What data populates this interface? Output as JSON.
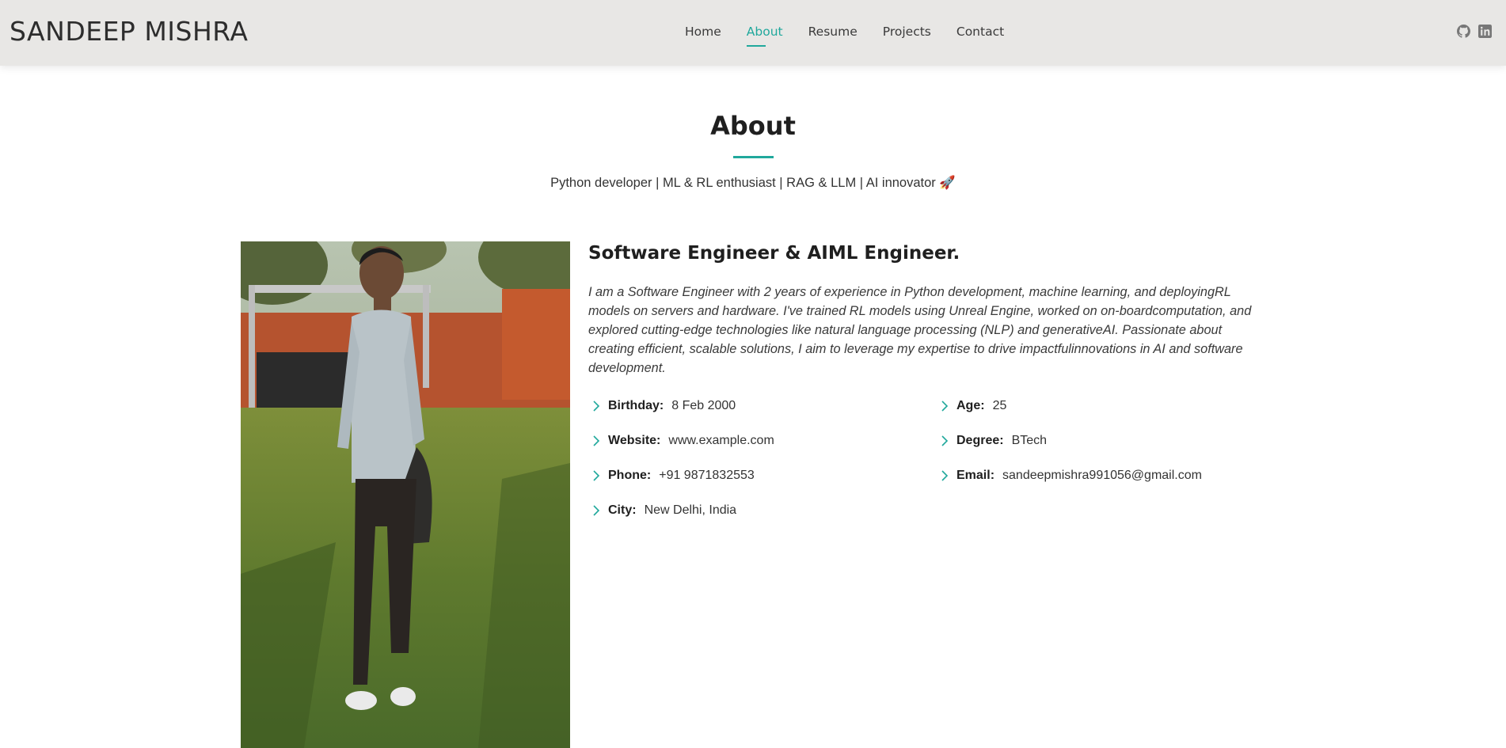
{
  "header": {
    "logo": "SANDEEP MISHRA",
    "nav": [
      "Home",
      "About",
      "Resume",
      "Projects",
      "Contact"
    ],
    "active_nav": "About",
    "socials": [
      "github-icon",
      "linkedin-icon"
    ]
  },
  "about": {
    "title": "About",
    "tagline": "Python developer | ML & RL enthusiast | RAG & LLM | AI innovator 🚀",
    "headline": "Software Engineer & AIML Engineer.",
    "bio": "I am a Software Engineer with 2 years of experience in Python development, machine learning, and deployingRL models on servers and hardware. I've trained RL models using Unreal Engine, worked on on-boardcomputation, and explored cutting-edge technologies like natural language processing (NLP) and generativeAI. Passionate about creating efficient, scalable solutions, I aim to leverage my expertise to drive impactfulinnovations in AI and software development.",
    "facts": [
      {
        "label": "Birthday:",
        "value": "8 Feb 2000"
      },
      {
        "label": "Age:",
        "value": "25"
      },
      {
        "label": "Website:",
        "value": "www.example.com"
      },
      {
        "label": "Degree:",
        "value": "BTech"
      },
      {
        "label": "Phone:",
        "value": "+91 9871832553"
      },
      {
        "label": "Email:",
        "value": "sandeepmishra991056@gmail.com"
      },
      {
        "label": "City:",
        "value": "New Delhi, India"
      }
    ]
  },
  "colors": {
    "accent": "#20a89c",
    "header_bg": "#e8e7e5"
  }
}
